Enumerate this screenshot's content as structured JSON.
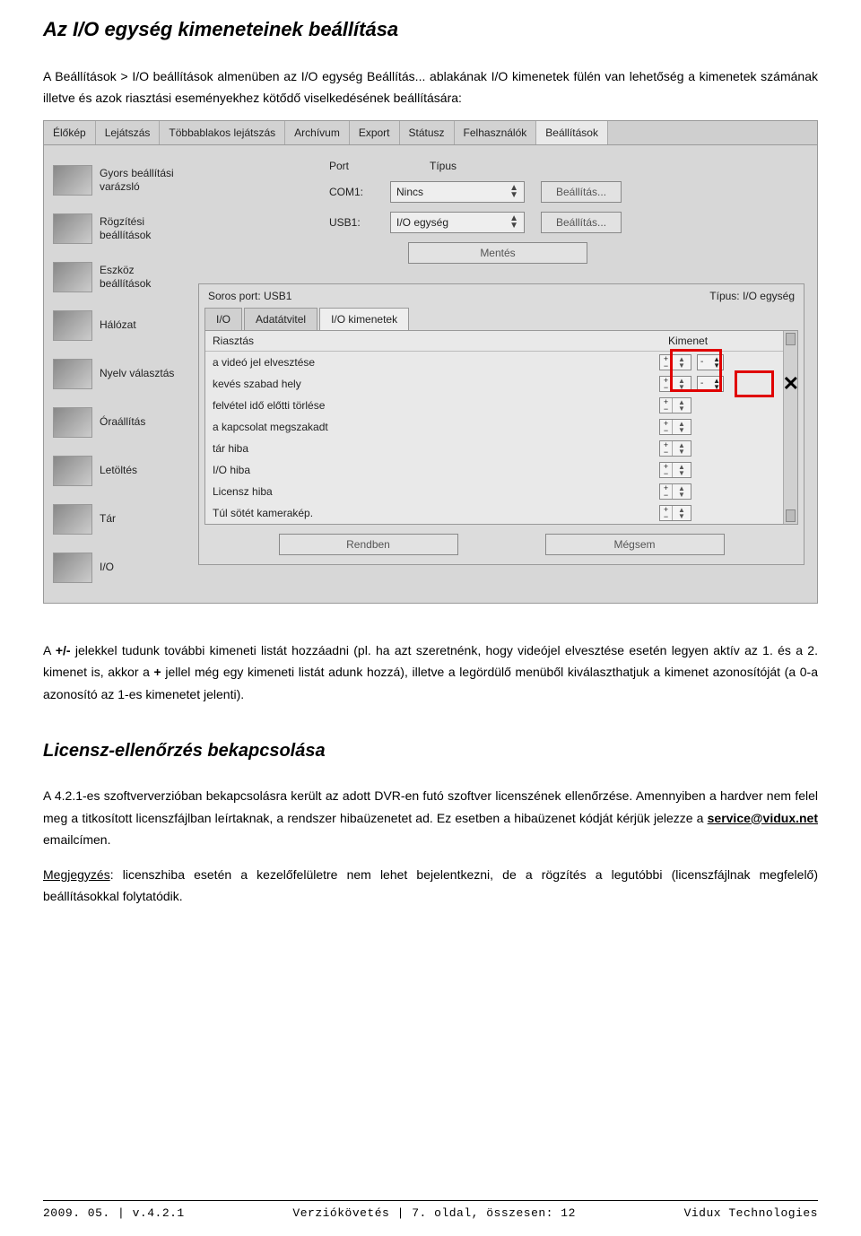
{
  "title": "Az I/O egység kimeneteinek beállítása",
  "intro": "A Beállítások > I/O beállítások almenüben az I/O egység Beállítás... ablakának I/O kimenetek fülén van lehetőség a kimenetek számának illetve és azok riasztási eseményekhez kötődő viselkedésének beállítására:",
  "tabs": [
    "Élőkép",
    "Lejátszás",
    "Többablakos lejátszás",
    "Archívum",
    "Export",
    "Státusz",
    "Felhasználók",
    "Beállítások"
  ],
  "active_tab": 7,
  "sidebar": {
    "items": [
      {
        "label": "Gyors beállítási varázsló"
      },
      {
        "label": "Rögzítési beállítások"
      },
      {
        "label": "Eszköz beállítások"
      },
      {
        "label": "Hálózat"
      },
      {
        "label": "Nyelv választás"
      },
      {
        "label": "Óraállítás"
      },
      {
        "label": "Letöltés"
      },
      {
        "label": "Tár"
      },
      {
        "label": "I/O"
      }
    ]
  },
  "ports": {
    "col1": "Port",
    "col2": "Típus",
    "rows": [
      {
        "label": "COM1:",
        "value": "Nincs",
        "btn": "Beállítás..."
      },
      {
        "label": "USB1:",
        "value": "I/O egység",
        "btn": "Beállítás..."
      }
    ],
    "save_btn": "Mentés"
  },
  "subpanel": {
    "left": "Soros port: USB1",
    "right": "Típus: I/O egység",
    "tabs": [
      "I/O",
      "Adatátvitel",
      "I/O kimenetek"
    ],
    "active": 2,
    "head_c1": "Riasztás",
    "head_c2": "Kimenet",
    "rows": [
      "a videó jel elvesztése",
      "kevés szabad hely",
      "felvétel idő előtti törlése",
      "a kapcsolat megszakadt",
      "tár hiba",
      "I/O hiba",
      "Licensz hiba",
      "Túl sötét kamerakép."
    ],
    "ok": "Rendben",
    "cancel": "Mégsem"
  },
  "after_p1_a": "A ",
  "after_p1_b": "+/-",
  "after_p1_c": " jelekkel tudunk további kimeneti listát hozzáadni (pl. ha azt szeretnénk, hogy videójel elvesztése esetén legyen aktív az 1. és a 2. kimenet is, akkor a ",
  "after_p1_d": "+",
  "after_p1_e": " jellel még egy kimeneti listát adunk hozzá), illetve a legördülő menüből kiválaszthatjuk a kimenet azonosítóját (a 0-a azonosító az 1-es kimenetet jelenti).",
  "section2_title": "Licensz-ellenőrzés bekapcsolása",
  "p2": "A 4.2.1-es szoftververzióban bekapcsolásra került az adott DVR-en futó szoftver licenszének ellenőrzése. Amennyiben a hardver nem felel meg a titkosított licenszfájlban leírtaknak, a rendszer hibaüzenetet ad. Ez esetben a hibaüzenet kódját kérjük jelezze a ",
  "p2_email": "service@vidux.net",
  "p2_tail": " emailcímen.",
  "note_label": "Megjegyzés",
  "note_body": ": licenszhiba esetén a kezelőfelületre nem lehet bejelentkezni, de a rögzítés a legutóbbi (licenszfájlnak megfelelő) beállításokkal folytatódik.",
  "footer": {
    "left": "2009. 05. | v.4.2.1",
    "center": "Verziókövetés | 7. oldal, összesen: 12",
    "right": "Vidux Technologies"
  }
}
